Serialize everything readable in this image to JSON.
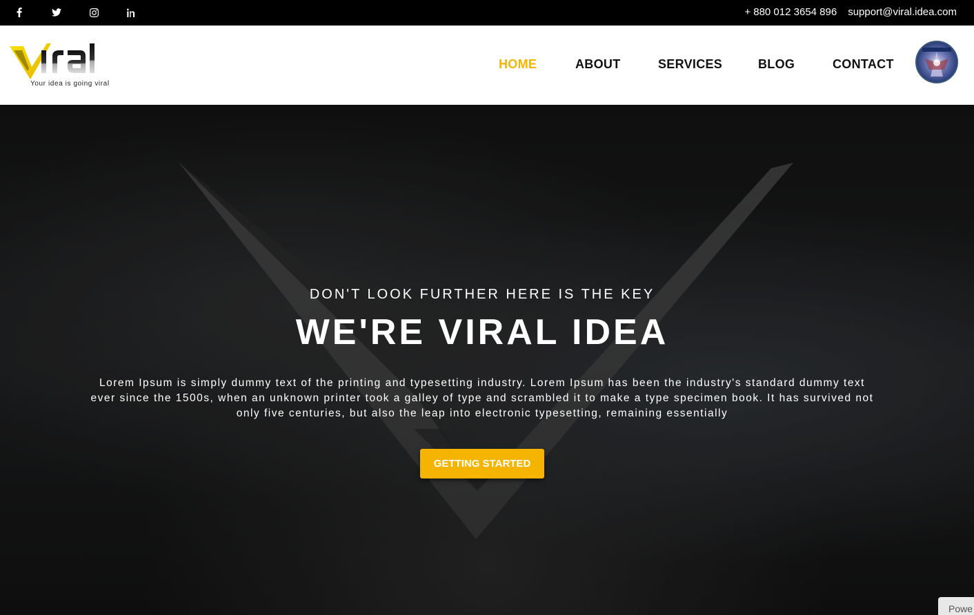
{
  "topbar": {
    "social": [
      {
        "name": "facebook-icon"
      },
      {
        "name": "twitter-icon"
      },
      {
        "name": "instagram-icon"
      },
      {
        "name": "linkedin-icon"
      }
    ],
    "phone": "+ 880 012 3654 896",
    "email": "support@viral.idea.com"
  },
  "header": {
    "logo_word": "Viral",
    "logo_tagline": "Your idea is going viral",
    "nav": [
      "HOME",
      "ABOUT",
      "SERVICES",
      "BLOG",
      "CONTACT"
    ],
    "active_nav": "HOME"
  },
  "hero": {
    "kicker": "DON'T LOOK FURTHER HERE IS THE KEY",
    "headline": "WE'RE VIRAL IDEA",
    "lead": "Lorem Ipsum is simply dummy text of the printing and typesetting industry. Lorem Ipsum has been the industry's standard dummy text ever since the 1500s, when an unknown printer took a galley of type and scrambled it to make a type specimen book. It has survived not only five centuries, but also the leap into electronic typesetting, remaining essentially",
    "cta": "GETTING STARTED"
  },
  "badge": {
    "powered": "Powe"
  },
  "colors": {
    "accent": "#f5b400",
    "topbar": "#000000",
    "header": "#ffffff"
  }
}
